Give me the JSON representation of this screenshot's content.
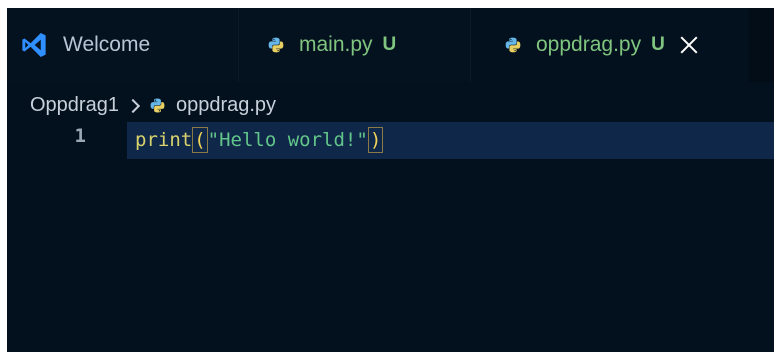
{
  "tabs": [
    {
      "label": "Welcome",
      "icon": "vscode-icon"
    },
    {
      "label": "main.py",
      "status": "U",
      "icon": "python-icon"
    },
    {
      "label": "oppdrag.py",
      "status": "U",
      "icon": "python-icon",
      "active": true,
      "close_icon": "close-icon"
    }
  ],
  "breadcrumb": {
    "folder": "Oppdrag1",
    "separator_icon": "chevron-right-icon",
    "file": "oppdrag.py",
    "file_icon": "python-icon"
  },
  "editor": {
    "lines": [
      {
        "number": "1",
        "tokens": {
          "function": "print",
          "open_paren": "(",
          "string": "\"Hello world!\"",
          "close_paren": ")"
        }
      }
    ]
  },
  "colors": {
    "background": "#03101d",
    "tab_inactive": "#04111f",
    "modified_green": "#7fc57f",
    "line_highlight": "#0f2748",
    "function_yellow": "#d9d36d",
    "bracket_yellow": "#f1d45b",
    "string_green": "#62c58a"
  }
}
